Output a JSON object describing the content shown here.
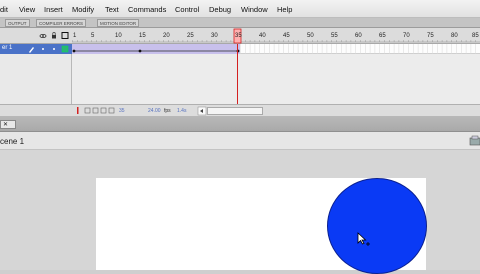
{
  "menu": [
    "dit",
    "View",
    "Insert",
    "Modify",
    "Text",
    "Commands",
    "Control",
    "Debug",
    "Window",
    "Help"
  ],
  "doc_tabs": [
    "OUTPUT",
    "COMPILER ERRORS",
    "MOTION EDITOR"
  ],
  "timeline": {
    "frame_numbers": [
      "1",
      "5",
      "10",
      "15",
      "20",
      "25",
      "30",
      "35",
      "40",
      "45",
      "50",
      "55",
      "60",
      "65",
      "70",
      "75",
      "80",
      "85"
    ],
    "layer_name": "er 1",
    "fps_value": "24.00",
    "fps_unit": "fps",
    "time": "1.4s",
    "current_frame": "35"
  },
  "scene": {
    "label": "cene 1"
  },
  "colors": {
    "circle_fill": "#0a3af5",
    "playhead": "#d42020",
    "layer_highlight": "#4a72c8"
  },
  "icons": [
    "eye-icon",
    "lock-icon",
    "outline-icon",
    "pencil-icon",
    "cursor-icon",
    "edit-scene-icon",
    "close-icon"
  ]
}
